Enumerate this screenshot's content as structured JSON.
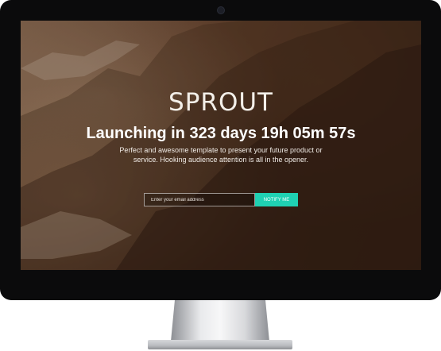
{
  "page": {
    "brand": "SPROUT",
    "headline": "Launching in 323 days 19h 05m 57s",
    "description": "Perfect and awesome template to present your future product or service. Hooking audience attention is all in the opener.",
    "email_placeholder": "Enter your email address",
    "notify_label": "NOTIFY ME"
  },
  "colors": {
    "accent": "#1fd1b3",
    "bezel": "#0b0b0c",
    "text": "#ffffff"
  },
  "icons": {
    "camera": "camera-icon"
  }
}
